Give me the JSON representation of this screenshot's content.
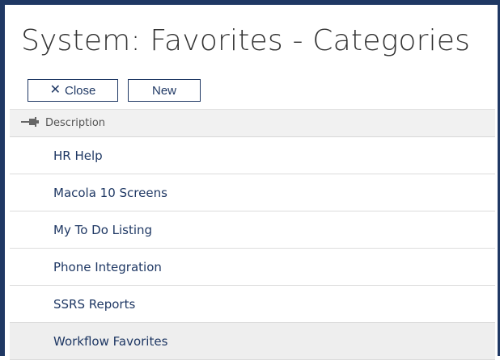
{
  "page": {
    "title": "System: Favorites - Categories"
  },
  "toolbar": {
    "close_label": "Close",
    "new_label": "New"
  },
  "grid": {
    "column_header": "Description",
    "rows": [
      {
        "label": "HR Help"
      },
      {
        "label": "Macola 10 Screens"
      },
      {
        "label": "My To Do Listing"
      },
      {
        "label": "Phone Integration"
      },
      {
        "label": "SSRS Reports"
      },
      {
        "label": "Workflow Favorites",
        "selected": true
      }
    ]
  },
  "colors": {
    "frame_border": "#1f3864",
    "link_text": "#1f3864",
    "header_bg": "#f1f1f1",
    "selected_row_bg": "#eeeeee"
  },
  "icons": {
    "close_button_icon": "close-icon",
    "column_icon": "pin-icon"
  }
}
